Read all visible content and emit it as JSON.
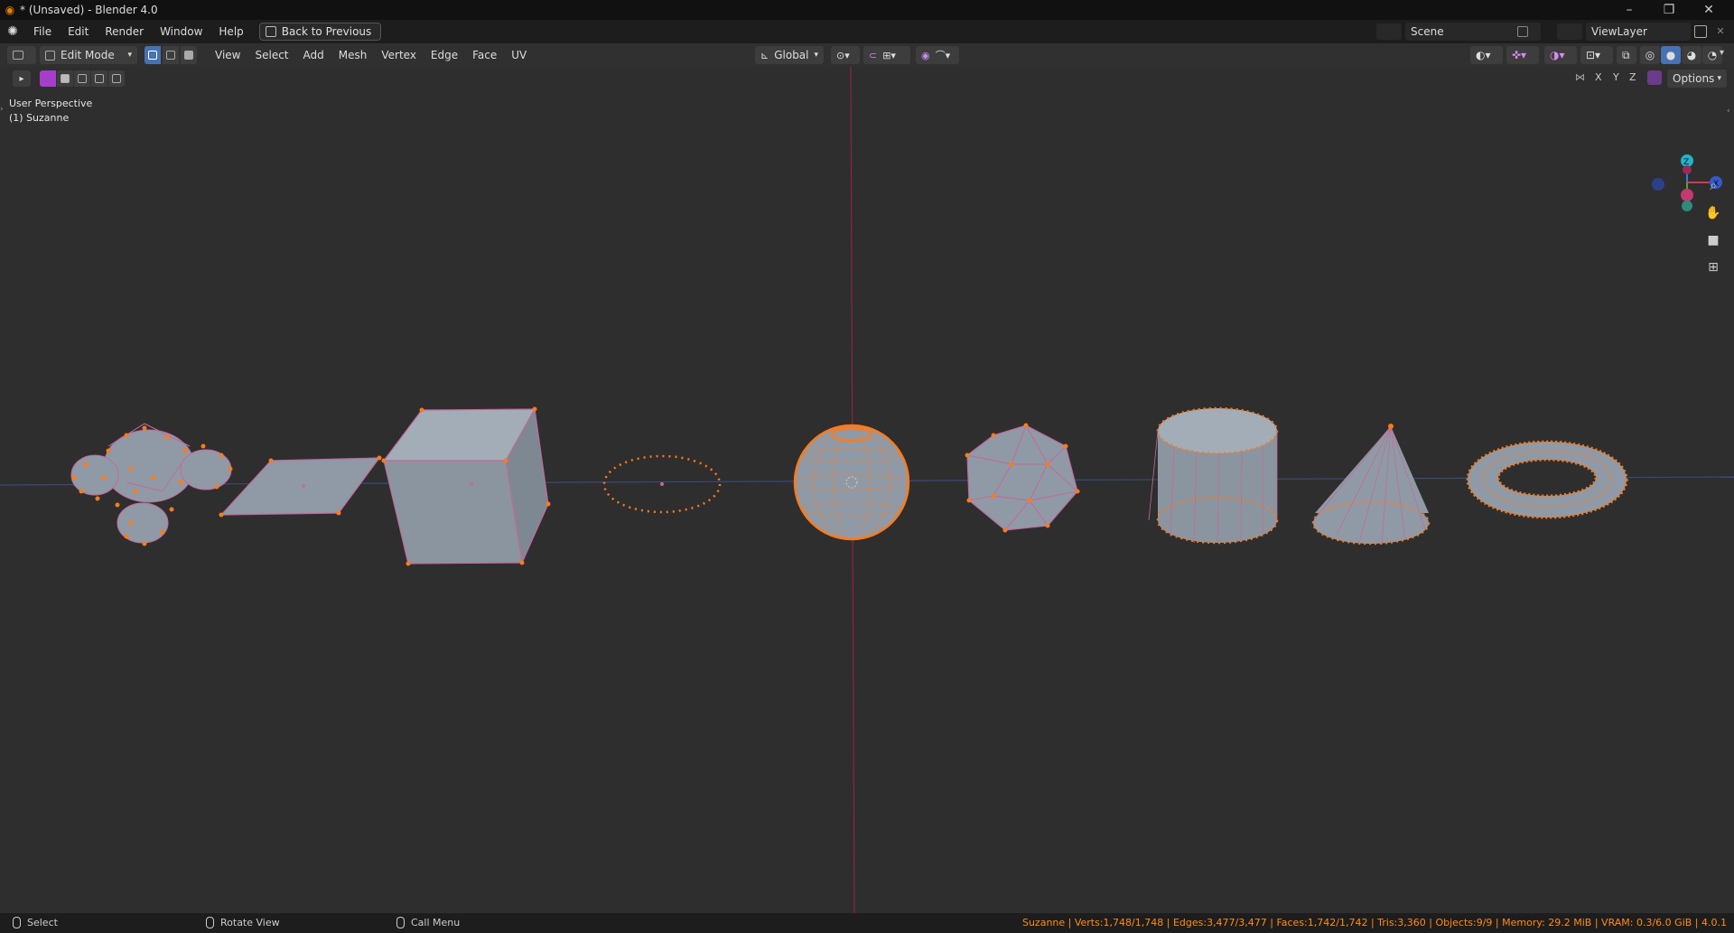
{
  "window": {
    "title": "* (Unsaved) - Blender 4.0",
    "controls": [
      "–",
      "❐",
      "✕"
    ]
  },
  "menubar": {
    "items": [
      "File",
      "Edit",
      "Render",
      "Window",
      "Help"
    ],
    "back_button": "Back to Previous",
    "scene": "Scene",
    "view_layer": "ViewLayer"
  },
  "viewport_header": {
    "mode": "Edit Mode",
    "menus": [
      "View",
      "Select",
      "Add",
      "Mesh",
      "Vertex",
      "Edge",
      "Face",
      "UV"
    ],
    "transform_orientation": "Global",
    "options": "Options",
    "axes": [
      "X",
      "Y",
      "Z"
    ]
  },
  "overlay": {
    "perspective": "User Perspective",
    "object": "(1) Suzanne"
  },
  "gizmo": {
    "z_label": "Z",
    "x_label": "X",
    "colors": {
      "x": "#e0314a",
      "y": "#5aa22f",
      "z": "#2d7fe0"
    }
  },
  "statusbar": {
    "hints": [
      "Select",
      "Rotate View",
      "Call Menu"
    ],
    "stats": "Suzanne | Verts:1,748/1,748 | Edges:3,477/3,477 | Faces:1,742/1,742 | Tris:3,360 | Objects:9/9 | Memory: 29.2 MiB | VRAM: 0.3/6.0 GiB | 4.0.1"
  },
  "colors": {
    "accent": "#a53fc9",
    "vertex": "#ff7a1a",
    "mesh_face": "#8f9aa6",
    "mesh_edge": "#c16b9b"
  },
  "objects": [
    "Suzanne",
    "Plane",
    "Cube",
    "Circle",
    "UV Sphere",
    "Ico Sphere",
    "Cylinder",
    "Cone",
    "Torus"
  ]
}
